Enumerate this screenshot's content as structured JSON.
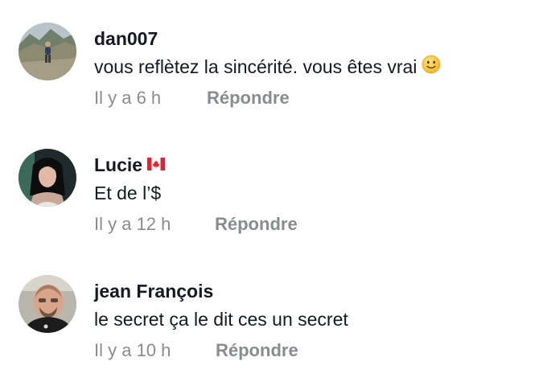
{
  "comments": [
    {
      "username": "dan007",
      "text": "vous reflètez la sincérité. vous êtes vrai",
      "emoji": "slightly-smiling-face",
      "time": "Il y a 6 h",
      "reply_label": "Répondre"
    },
    {
      "username": "Lucie",
      "flag": "canada-flag",
      "text": "Et de l’$",
      "time": "Il y a 12 h",
      "reply_label": "Répondre"
    },
    {
      "username": "jean François",
      "text": "le secret ça le dit ces un secret",
      "time": "Il y a 10 h",
      "reply_label": "Répondre"
    }
  ]
}
